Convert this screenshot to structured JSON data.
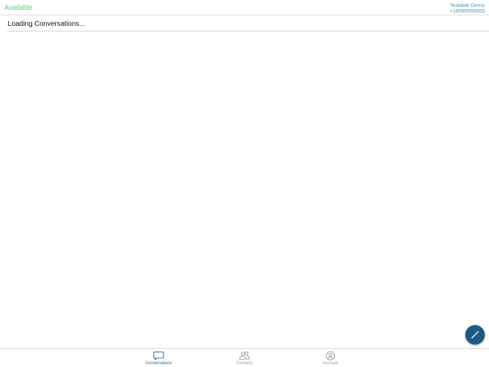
{
  "header": {
    "status": "Available",
    "account_name": "Textable Demo",
    "account_number": "+16095555555"
  },
  "main": {
    "loading_text": "Loading Conversations..."
  },
  "compose": {
    "icon": "pencil-icon"
  },
  "tabbar": {
    "tabs": [
      {
        "label": "Conversations",
        "icon": "chat-bubble-icon",
        "active": true
      },
      {
        "label": "Contacts",
        "icon": "people-icon",
        "active": false
      },
      {
        "label": "Account",
        "icon": "user-circle-icon",
        "active": false
      }
    ]
  },
  "colors": {
    "status_green": "#4cd07a",
    "account_blue": "#5a8db3",
    "accent_blue": "#2a6b96",
    "fab_blue": "#1e5b82",
    "inactive_gray": "#9a9a9a"
  }
}
